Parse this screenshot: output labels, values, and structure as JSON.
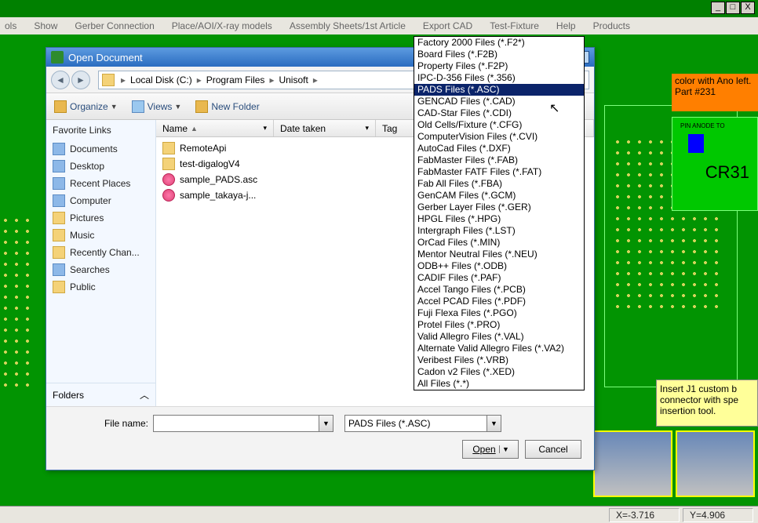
{
  "window_controls": {
    "min": "_",
    "max": "□",
    "close": "X"
  },
  "menubar": [
    "ols",
    "Show",
    "Gerber Connection",
    "Place/AOI/X-ray models",
    "Assembly Sheets/1st Article",
    "Export CAD",
    "Test-Fixture",
    "Help",
    "Products"
  ],
  "status": {
    "x": "X=-3.716",
    "y": "Y=4.906"
  },
  "pcb": {
    "orange_note": "color with Ano left.   Part #231",
    "cr_label": "CR31",
    "yellow_note": "Insert J1 custom b connector with spe insertion tool.",
    "pin_text": "PIN ANODE TO"
  },
  "dialog": {
    "title": "Open Document",
    "breadcrumbs": [
      "Local Disk (C:)",
      "Program Files",
      "Unisoft"
    ],
    "toolbar": {
      "organize": "Organize",
      "views": "Views",
      "newfolder": "New Folder"
    },
    "favorites_header": "Favorite Links",
    "favorites": [
      "Documents",
      "Desktop",
      "Recent Places",
      "Computer",
      "Pictures",
      "Music",
      "Recently Chan...",
      "Searches",
      "Public"
    ],
    "folders_label": "Folders",
    "columns": {
      "name": "Name",
      "date": "Date taken",
      "tags": "Tag"
    },
    "rows": [
      {
        "icon": "folder",
        "name": "RemoteApi"
      },
      {
        "icon": "folder",
        "name": "test-digalogV4"
      },
      {
        "icon": "file",
        "name": "sample_PADS.asc"
      },
      {
        "icon": "file",
        "name": "sample_takaya-j..."
      }
    ],
    "file_name_label": "File name:",
    "file_name_value": "",
    "filter_value": "PADS Files (*.ASC)",
    "open_label": "Open",
    "cancel_label": "Cancel",
    "filter_options": [
      "Factory 2000 Files (*.F2*)",
      "Board Files (*.F2B)",
      "Property Files (*.F2P)",
      "IPC-D-356 Files (*.356)",
      "PADS Files (*.ASC)",
      "GENCAD Files (*.CAD)",
      "CAD-Star Files (*.CDI)",
      "Old Cells/Fixture (*.CFG)",
      "ComputerVision Files (*.CVI)",
      "AutoCad Files (*.DXF)",
      "FabMaster Files (*.FAB)",
      "FabMaster FATF Files (*.FAT)",
      "Fab All Files (*.FBA)",
      "GenCAM Files (*.GCM)",
      "Gerber Layer Files (*.GER)",
      "HPGL Files (*.HPG)",
      "Intergraph Files (*.LST)",
      "OrCad Files (*.MIN)",
      "Mentor Neutral Files (*.NEU)",
      "ODB++ Files (*.ODB)",
      "CADIF Files (*.PAF)",
      "Accel Tango Files (*.PCB)",
      "Accel PCAD Files (*.PDF)",
      "Fuji Flexa Files (*.PGO)",
      "Protel Files (*.PRO)",
      "Valid Allegro Files (*.VAL)",
      "Alternate Valid Allegro Files (*.VA2)",
      "Veribest Files (*.VRB)",
      "Cadon v2 Files (*.XED)",
      "All Files (*.*)"
    ],
    "filter_selected_index": 4
  }
}
